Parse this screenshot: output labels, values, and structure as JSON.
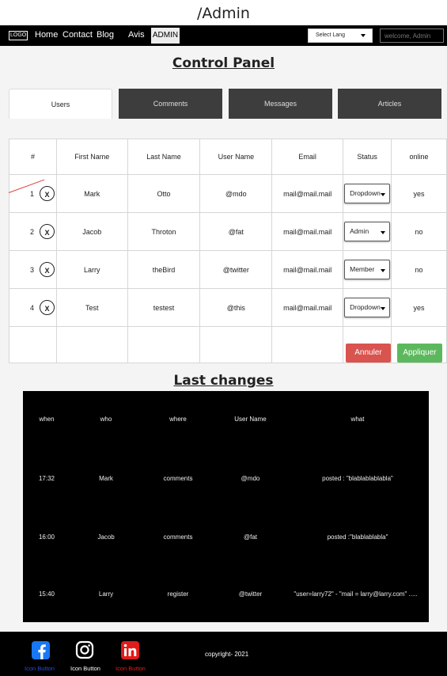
{
  "page": {
    "path_title": "/Admin"
  },
  "nav": {
    "logo": "LOGO",
    "links": [
      "Home",
      "Contact",
      "Blog",
      "Avis"
    ],
    "admin_tab": "ADMIN",
    "lang_select": "Select Lang",
    "welcome_placeholder": "welcome, Admin"
  },
  "control_panel": {
    "title": "Control Panel",
    "tabs": [
      "Users",
      "Comments",
      "Messages",
      "Articles"
    ],
    "columns": [
      "#",
      "First Name",
      "Last Name",
      "User Name",
      "Email",
      "Status",
      "online"
    ],
    "rows": [
      {
        "idx": "1",
        "first": "Mark",
        "last": "Otto",
        "user": "@mdo",
        "email": "mail@mail.mail",
        "status": "Dropdown",
        "online": "yes"
      },
      {
        "idx": "2",
        "first": "Jacob",
        "last": "Throton",
        "user": "@fat",
        "email": "mail@mail.mail",
        "status": "Admin",
        "online": "no"
      },
      {
        "idx": "3",
        "first": "Larry",
        "last": "theBird",
        "user": "@twitter",
        "email": "mail@mail.mail",
        "status": "Member",
        "online": "no"
      },
      {
        "idx": "4",
        "first": "Test",
        "last": "testest",
        "user": "@this",
        "email": "mail@mail.mail",
        "status": "Dropdown",
        "online": "yes"
      }
    ],
    "delete_glyph": "X",
    "cancel_label": "Annuler",
    "apply_label": "Appliquer"
  },
  "last_changes": {
    "title": "Last changes",
    "headers": [
      "when",
      "who",
      "where",
      "User Name",
      "what"
    ],
    "rows": [
      [
        "17:32",
        "Mark",
        "comments",
        "@mdo",
        "posted : \"blablablablabla\""
      ],
      [
        "16:00",
        "Jacob",
        "comments",
        "@fat",
        "posted :\"blablablabla\""
      ],
      [
        "15:40",
        "Larry",
        "register",
        "@twitter",
        "\"user=larry72\" - \"mail = larry@larry.com\" ....."
      ]
    ]
  },
  "footer": {
    "icon_labels": [
      "Icon Button",
      "Icon Button",
      "Icon Button"
    ],
    "copyright": "copyright- 2021",
    "colors": {
      "facebook": "#1877f2",
      "linkedin": "#e21b1b",
      "fb_label": "#2a4bd7",
      "li_label": "#e02020"
    }
  }
}
